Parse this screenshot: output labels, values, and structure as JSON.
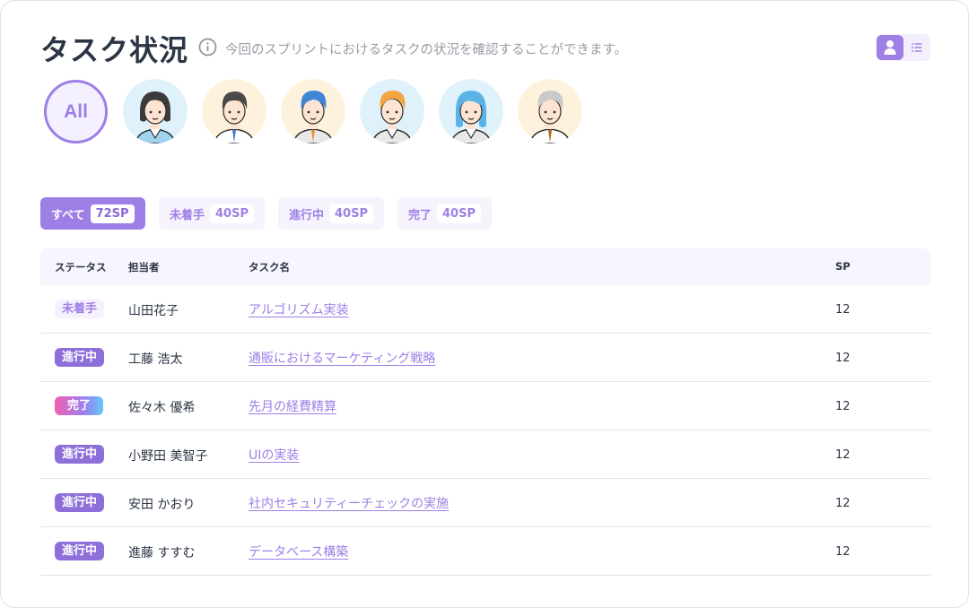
{
  "header": {
    "title": "タスク状況",
    "subtitle": "今回のスプリントにおけるタスクの状況を確認することができます。",
    "info_icon": "info-circle-icon",
    "view_toggle": {
      "user_icon": "user-icon",
      "list_icon": "list-icon"
    }
  },
  "avatars": {
    "all_label": "All",
    "members": [
      {
        "icon": "woman-avatar-icon",
        "bg": "#dff1fb"
      },
      {
        "icon": "man-avatar-icon",
        "bg": "#fff2dc"
      },
      {
        "icon": "man-blue-hair-avatar-icon",
        "bg": "#fff2dc"
      },
      {
        "icon": "man-orange-hair-avatar-icon",
        "bg": "#dff1fb"
      },
      {
        "icon": "woman-blue-hair-avatar-icon",
        "bg": "#dff1fb"
      },
      {
        "icon": "man-gray-hair-avatar-icon",
        "bg": "#fff2dc"
      }
    ]
  },
  "filters": [
    {
      "label": "すべて",
      "count": "72SP",
      "active": true
    },
    {
      "label": "未着手",
      "count": "40SP",
      "active": false
    },
    {
      "label": "進行中",
      "count": "40SP",
      "active": false
    },
    {
      "label": "完了",
      "count": "40SP",
      "active": false
    }
  ],
  "table": {
    "headers": {
      "status": "ステータス",
      "assignee": "担当者",
      "task": "タスク名",
      "sp": "SP"
    },
    "rows": [
      {
        "status": "未着手",
        "status_type": "todo",
        "assignee": "山田花子",
        "task": "アルゴリズム実装",
        "sp": "12"
      },
      {
        "status": "進行中",
        "status_type": "doing",
        "assignee": "工藤 浩太",
        "task": "通販におけるマーケティング戦略",
        "sp": "12"
      },
      {
        "status": "完了",
        "status_type": "done",
        "assignee": "佐々木 優希",
        "task": "先月の経費精算",
        "sp": "12"
      },
      {
        "status": "進行中",
        "status_type": "doing",
        "assignee": "小野田 美智子",
        "task": "UIの実装",
        "sp": "12"
      },
      {
        "status": "進行中",
        "status_type": "doing",
        "assignee": "安田 かおり",
        "task": "社内セキュリティーチェックの実施",
        "sp": "12"
      },
      {
        "status": "進行中",
        "status_type": "doing",
        "assignee": "進藤 すすむ",
        "task": "データベース構築",
        "sp": "12"
      }
    ]
  },
  "colors": {
    "accent": "#9d7fe6",
    "border": "#e4e4ea"
  }
}
